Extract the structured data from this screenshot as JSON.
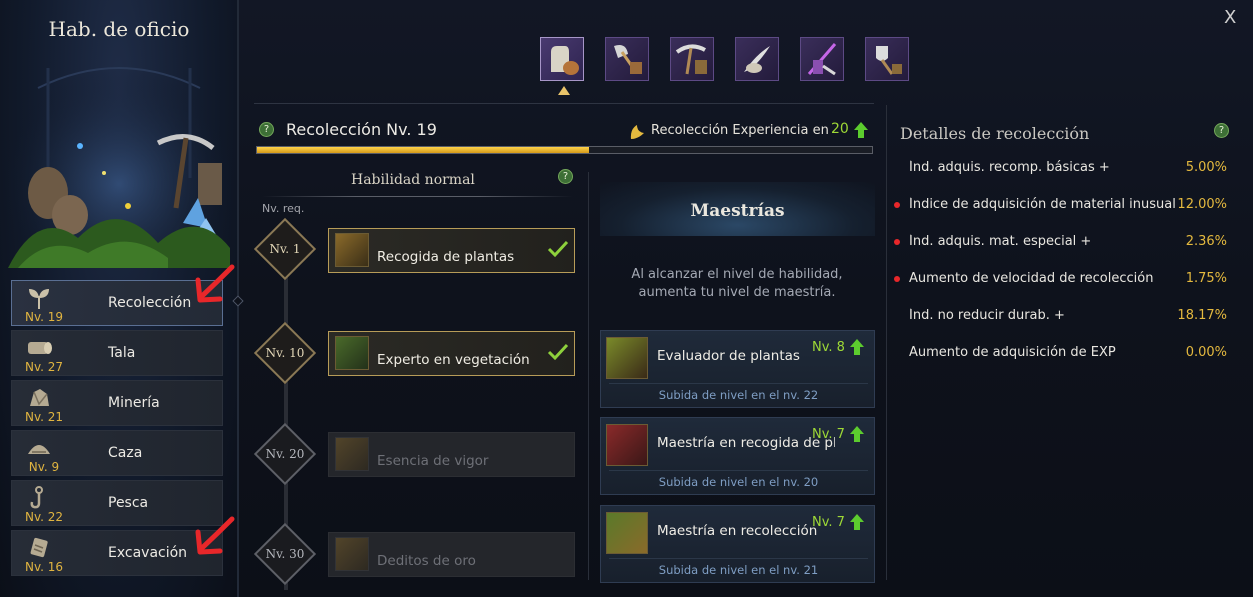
{
  "window": {
    "title": "Hab. de oficio",
    "close_label": "X"
  },
  "professions": [
    {
      "name": "Recolección",
      "level": "Nv. 19",
      "icon": "sprout-icon",
      "active": true
    },
    {
      "name": "Tala",
      "level": "Nv. 27",
      "icon": "log-icon",
      "active": false
    },
    {
      "name": "Minería",
      "level": "Nv. 21",
      "icon": "ore-icon",
      "active": false
    },
    {
      "name": "Caza",
      "level": "Nv. 9",
      "icon": "hunting-icon",
      "active": false
    },
    {
      "name": "Pesca",
      "level": "Nv. 22",
      "icon": "fishhook-icon",
      "active": false
    },
    {
      "name": "Excavación",
      "level": "Nv. 16",
      "icon": "shovel-icon",
      "active": false
    }
  ],
  "tools": [
    "gloves-tool-icon",
    "axe-tool-icon",
    "pickaxe-tool-icon",
    "hunting-knife-tool-icon",
    "fishing-rod-tool-icon",
    "shovel-tool-icon"
  ],
  "header": {
    "title": "Recolección Nv. 19",
    "exp_label": "Recolección Experiencia en",
    "exp_value": "20",
    "progress": 0.54
  },
  "skills": {
    "heading": "Habilidad normal",
    "req_label": "Nv. req.",
    "items": [
      {
        "level": "Nv. 1",
        "name": "Recogida de plantas",
        "unlocked": true
      },
      {
        "level": "Nv. 10",
        "name": "Experto en vegetación",
        "unlocked": true
      },
      {
        "level": "Nv. 20",
        "name": "Esencia de vigor",
        "unlocked": false
      },
      {
        "level": "Nv. 30",
        "name": "Deditos de oro",
        "unlocked": false
      }
    ]
  },
  "masteries": {
    "title": "Maestrías",
    "description": "Al alcanzar el nivel de habilidad, aumenta tu nivel de maestría.",
    "items": [
      {
        "name": "Evaluador de plantas",
        "level": "Nv. 8",
        "sub": "Subida de nivel en el nv. 22"
      },
      {
        "name": "Maestría en recogida de plantas",
        "level": "Nv. 7",
        "sub": "Subida de nivel en el nv. 20"
      },
      {
        "name": "Maestría en recolección",
        "level": "Nv. 7",
        "sub": "Subida de nivel en el nv. 21"
      }
    ]
  },
  "details": {
    "title": "Detalles de recolección",
    "rows": [
      {
        "label": "Índ. adquis. recomp. básicas +",
        "value": "5.00%",
        "marked": false
      },
      {
        "label": "Índice de adquisición de material inusual +",
        "value": "12.00%",
        "marked": true
      },
      {
        "label": "Índ. adquis. mat. especial +",
        "value": "2.36%",
        "marked": true
      },
      {
        "label": "Aumento de velocidad de recolección",
        "value": "1.75%",
        "marked": true
      },
      {
        "label": "Índ. no reducir durab. +",
        "value": "18.17%",
        "marked": false
      },
      {
        "label": "Aumento de adquisición de EXP",
        "value": "0.00%",
        "marked": false
      }
    ]
  },
  "colors": {
    "accent_gold": "#e4b93f",
    "level_green": "#9ed936",
    "marker_red": "#e8272a",
    "annotation_red": "#e8272a"
  }
}
